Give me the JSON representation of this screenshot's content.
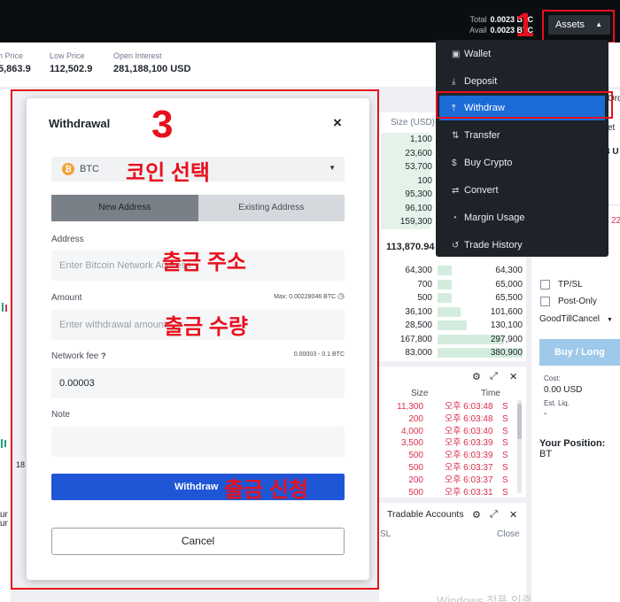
{
  "topbar": {
    "total_label": "Total",
    "total_value": "0.0023 BTC",
    "avail_label": "Avail",
    "avail_value": "0.0023 BTC",
    "assets_label": "Assets"
  },
  "stats": [
    {
      "label": "h Price",
      "value": "5,863.9"
    },
    {
      "label": "Low Price",
      "value": "112,502.9"
    },
    {
      "label": "Open Interest",
      "value": "281,188,100 USD"
    }
  ],
  "assets_menu": [
    {
      "label": "Wallet",
      "icon": "wallet-icon",
      "glyph": "▣"
    },
    {
      "label": "Deposit",
      "icon": "download-icon",
      "glyph": "⤓"
    },
    {
      "label": "Withdraw",
      "icon": "upload-icon",
      "glyph": "⤒"
    },
    {
      "label": "Transfer",
      "icon": "transfer-icon",
      "glyph": "⇅"
    },
    {
      "label": "Buy Crypto",
      "icon": "coin-icon",
      "glyph": "$"
    },
    {
      "label": "Convert",
      "icon": "convert-icon",
      "glyph": "⇄"
    },
    {
      "label": "Margin Usage",
      "icon": "pie-icon",
      "glyph": "◔"
    },
    {
      "label": "Trade History",
      "icon": "history-icon",
      "glyph": "↺"
    }
  ],
  "annotations": {
    "n1": "1",
    "n3": "3",
    "coin_select": "코인 선택",
    "address": "출금 주소",
    "amount": "출금 수량",
    "submit": "출금 신청"
  },
  "modal": {
    "title": "Withdrawal",
    "close_glyph": "×",
    "coin": "BTC",
    "coin_glyph": "₿",
    "tab_new": "New Address",
    "tab_existing": "Existing Address",
    "address_label": "Address",
    "address_placeholder": "Enter Bitcoin Network Address",
    "amount_label": "Amount",
    "amount_max": "Max: 0.00228046 BTC",
    "amount_placeholder": "Enter withdrawal amount",
    "fee_label": "Network fee",
    "fee_range": "0.00003 - 0.1 BTC",
    "fee_value": "0.00003",
    "note_label": "Note",
    "withdraw_label": "Withdraw",
    "cancel_label": "Cancel"
  },
  "orderbook": {
    "header_size": "Size (USD)",
    "mid_price": "113,870.94",
    "asks": [
      {
        "size": "1,100",
        "total": ""
      },
      {
        "size": "23,600",
        "total": ""
      },
      {
        "size": "53,700",
        "total": ""
      },
      {
        "size": "100",
        "total": ""
      },
      {
        "size": "95,300",
        "total": ""
      },
      {
        "size": "96,100",
        "total": ""
      },
      {
        "size": "159,300",
        "total": ""
      }
    ],
    "bids": [
      {
        "size": "64,300",
        "total": "64,300",
        "fill": 0.17
      },
      {
        "size": "700",
        "total": "65,000",
        "fill": 0.17
      },
      {
        "size": "500",
        "total": "65,500",
        "fill": 0.17
      },
      {
        "size": "36,100",
        "total": "101,600",
        "fill": 0.27
      },
      {
        "size": "28,500",
        "total": "130,100",
        "fill": 0.34
      },
      {
        "size": "167,800",
        "total": "297,900",
        "fill": 0.78
      },
      {
        "size": "83,000",
        "total": "380,900",
        "fill": 1.0
      }
    ]
  },
  "trades": {
    "header_size": "Size",
    "header_time": "Time",
    "rows": [
      {
        "size": "11,300",
        "time": "오후 6:03:48",
        "side": "S"
      },
      {
        "size": "200",
        "time": "오후 6:03:48",
        "side": "S"
      },
      {
        "size": "4,000",
        "time": "오후 6:03:40",
        "side": "S"
      },
      {
        "size": "3,500",
        "time": "오후 6:03:39",
        "side": "S"
      },
      {
        "size": "500",
        "time": "오후 6:03:39",
        "side": "S"
      },
      {
        "size": "500",
        "time": "오후 6:03:37",
        "side": "S"
      },
      {
        "size": "200",
        "time": "오후 6:03:37",
        "side": "S"
      },
      {
        "size": "500",
        "time": "오후 6:03:31",
        "side": "S"
      }
    ]
  },
  "tradable": {
    "title": "Tradable Accounts",
    "col_left": "SL",
    "col_right": "Close"
  },
  "order_panel": {
    "tpsl": "TP/SL",
    "post_only": "Post-Only",
    "tif": "GoodTillCancel",
    "buy_long": "Buy / Long",
    "cost_label": "Cost:",
    "cost_value": "0.00 USD",
    "liq_label": "Est. Liq.",
    "liq_value": "-",
    "position_label": "Your Position:",
    "position_value": "BT"
  },
  "edge_fragments": {
    "ord": "Ord",
    "et": "et",
    "s3u": "3 U",
    "t22": "22",
    "ur": "ur",
    "ur2": "ur I",
    "n18": "18"
  },
  "watermark": "Windows 정품 인증",
  "colors": {
    "accent": "#1f56d6",
    "annotation": "#e8101d",
    "sell": "#d9304e",
    "buy_fill": "#d3ecdd"
  }
}
